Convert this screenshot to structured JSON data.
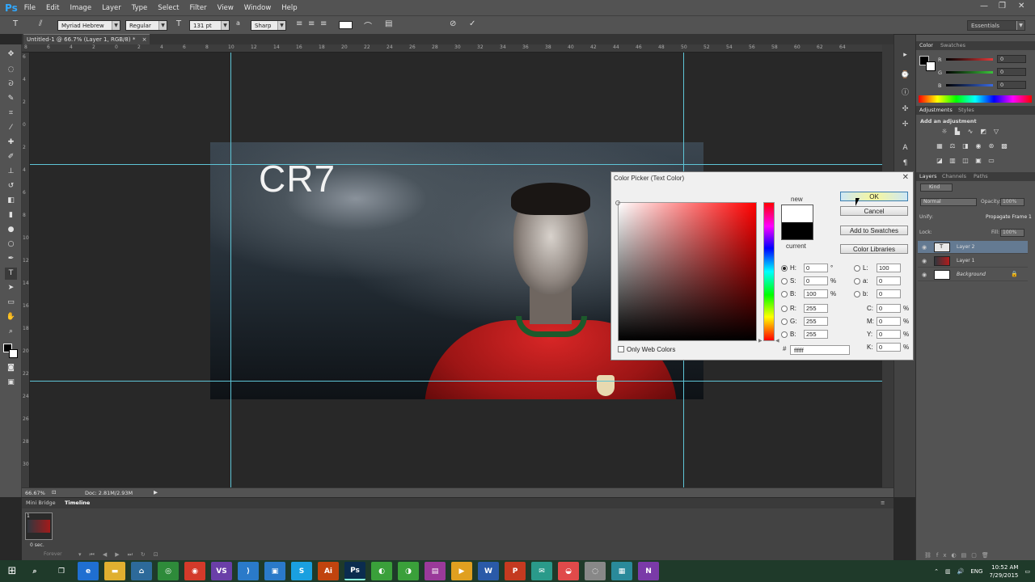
{
  "app": {
    "logo": "Ps",
    "menu": [
      "File",
      "Edit",
      "Image",
      "Layer",
      "Type",
      "Select",
      "Filter",
      "View",
      "Window",
      "Help"
    ],
    "window_controls": [
      "—",
      "❐",
      "✕"
    ]
  },
  "options_bar": {
    "font_family": "Myriad Hebrew",
    "font_style": "Regular",
    "font_size": "131 pt",
    "antialias": "Sharp",
    "workspace": "Essentials"
  },
  "document": {
    "tab_title": "Untitled-1 @ 66.7% (Layer 1, RGB/8) *",
    "zoom": "66.67%",
    "doc_size": "Doc: 2.81M/2.93M",
    "canvas_text": "CR7"
  },
  "ruler": {
    "top_labels": [
      "8",
      "6",
      "4",
      "2",
      "0",
      "2",
      "4",
      "6",
      "8",
      "10",
      "12",
      "14",
      "16",
      "18",
      "20",
      "22",
      "24",
      "26",
      "28",
      "30",
      "32",
      "34",
      "36",
      "38",
      "40",
      "42",
      "44",
      "46",
      "48",
      "50",
      "52",
      "54",
      "56",
      "58",
      "60",
      "62",
      "64"
    ],
    "left_labels": [
      "6",
      "4",
      "2",
      "0",
      "2",
      "4",
      "6",
      "8",
      "10",
      "12",
      "14",
      "16",
      "18",
      "20",
      "22",
      "24",
      "26",
      "28",
      "30"
    ]
  },
  "bottom_panel": {
    "tabs": [
      "Mini Bridge",
      "Timeline"
    ],
    "frame_number": "1",
    "frame_delay": "0 sec.",
    "loop": "Forever"
  },
  "color_panel": {
    "tabs": [
      "Color",
      "Swatches"
    ],
    "channels": [
      {
        "label": "R",
        "value": "0",
        "color": "#e23a3a"
      },
      {
        "label": "G",
        "value": "0",
        "color": "#3ac43a"
      },
      {
        "label": "B",
        "value": "0",
        "color": "#3a6ae2"
      }
    ]
  },
  "adjustments_panel": {
    "tabs": [
      "Adjustments",
      "Styles"
    ],
    "title": "Add an adjustment"
  },
  "layers_panel": {
    "tabs": [
      "Layers",
      "Channels",
      "Paths"
    ],
    "filter_kind": "Kind",
    "blend_mode": "Normal",
    "opacity_label": "Opacity:",
    "opacity_value": "100%",
    "unify_label": "Unify:",
    "propagate_label": "Propagate Frame 1",
    "lock_label": "Lock:",
    "fill_label": "Fill:",
    "fill_value": "100%",
    "layers": [
      {
        "name": "Layer 2",
        "selected": true
      },
      {
        "name": "Layer 1",
        "selected": false
      },
      {
        "name": "Background",
        "selected": false
      }
    ]
  },
  "color_picker": {
    "title": "Color Picker (Text Color)",
    "close": "✕",
    "new_label": "new",
    "current_label": "current",
    "new_color": "#ffffff",
    "current_color": "#000000",
    "buttons": {
      "ok": "OK",
      "cancel": "Cancel",
      "add": "Add to Swatches",
      "libraries": "Color Libraries"
    },
    "hsb": [
      {
        "label": "H:",
        "value": "0",
        "unit": "°",
        "selected": true
      },
      {
        "label": "S:",
        "value": "0",
        "unit": "%",
        "selected": false
      },
      {
        "label": "B:",
        "value": "100",
        "unit": "%",
        "selected": false
      }
    ],
    "rgb": [
      {
        "label": "R:",
        "value": "255"
      },
      {
        "label": "G:",
        "value": "255"
      },
      {
        "label": "B:",
        "value": "255"
      }
    ],
    "lab": [
      {
        "label": "L:",
        "value": "100"
      },
      {
        "label": "a:",
        "value": "0"
      },
      {
        "label": "b:",
        "value": "0"
      }
    ],
    "cmyk": [
      {
        "label": "C:",
        "value": "0",
        "unit": "%"
      },
      {
        "label": "M:",
        "value": "0",
        "unit": "%"
      },
      {
        "label": "Y:",
        "value": "0",
        "unit": "%"
      },
      {
        "label": "K:",
        "value": "0",
        "unit": "%"
      }
    ],
    "only_web": "Only Web Colors",
    "hex_label": "#",
    "hex": "ffffff"
  },
  "taskbar": {
    "apps": [
      {
        "name": "search-app",
        "glyph": "⌕",
        "color": "#1f3a2a"
      },
      {
        "name": "task-view-app",
        "glyph": "❐",
        "color": "#1f3a2a"
      },
      {
        "name": "edge-app",
        "glyph": "e",
        "color": "#1f6fd1"
      },
      {
        "name": "explorer-app",
        "glyph": "▬",
        "color": "#e0b030"
      },
      {
        "name": "store-app",
        "glyph": "⌂",
        "color": "#2d6a9a"
      },
      {
        "name": "chrome-app",
        "glyph": "◎",
        "color": "#2e8b3a"
      },
      {
        "name": "chrome2-app",
        "glyph": "◉",
        "color": "#d33a2a"
      },
      {
        "name": "visualstudio-app",
        "glyph": "VS",
        "color": "#6a3fa8"
      },
      {
        "name": "vscode-app",
        "glyph": "⟩",
        "color": "#2a7ac9"
      },
      {
        "name": "app-10",
        "glyph": "▣",
        "color": "#2a7ac9"
      },
      {
        "name": "skype-app",
        "glyph": "S",
        "color": "#1aa0e0"
      },
      {
        "name": "illustrator-app",
        "glyph": "Ai",
        "color": "#c1440e"
      },
      {
        "name": "photoshop-app",
        "glyph": "Ps",
        "color": "#0b2c4e"
      },
      {
        "name": "app-14",
        "glyph": "◐",
        "color": "#3aa03a"
      },
      {
        "name": "app-15",
        "glyph": "◑",
        "color": "#3aa03a"
      },
      {
        "name": "app-16",
        "glyph": "▤",
        "color": "#9a3a9a"
      },
      {
        "name": "app-17",
        "glyph": "▶",
        "color": "#e0a020"
      },
      {
        "name": "word-app",
        "glyph": "W",
        "color": "#2a5aa8"
      },
      {
        "name": "powerpoint-app",
        "glyph": "P",
        "color": "#c43a20"
      },
      {
        "name": "app-20",
        "glyph": "✉",
        "color": "#2a9a8a"
      },
      {
        "name": "app-21",
        "glyph": "◒",
        "color": "#e04a4a"
      },
      {
        "name": "app-22",
        "glyph": "◌",
        "color": "#888"
      },
      {
        "name": "app-23",
        "glyph": "▦",
        "color": "#2a8a9a"
      },
      {
        "name": "onenote-app",
        "glyph": "N",
        "color": "#7a3aa8"
      }
    ],
    "language": "ENG",
    "time": "10:52 AM",
    "date": "7/29/2015"
  }
}
